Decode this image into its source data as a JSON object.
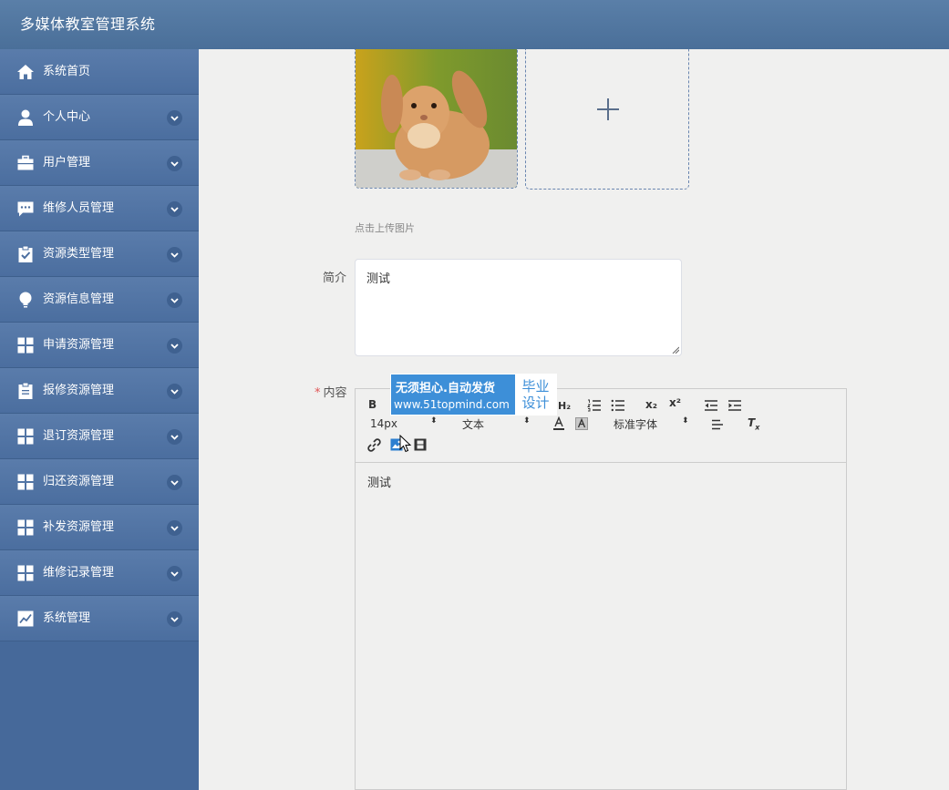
{
  "app": {
    "title": "多媒体教室管理系统"
  },
  "sidebar": {
    "items": [
      {
        "label": "系统首页",
        "icon": "home-icon",
        "expandable": false
      },
      {
        "label": "个人中心",
        "icon": "user-icon",
        "expandable": true
      },
      {
        "label": "用户管理",
        "icon": "briefcase-icon",
        "expandable": true
      },
      {
        "label": "维修人员管理",
        "icon": "chat-icon",
        "expandable": true
      },
      {
        "label": "资源类型管理",
        "icon": "clipboard-check-icon",
        "expandable": true
      },
      {
        "label": "资源信息管理",
        "icon": "bulb-icon",
        "expandable": true
      },
      {
        "label": "申请资源管理",
        "icon": "grid-icon",
        "expandable": true
      },
      {
        "label": "报修资源管理",
        "icon": "clipboard-icon",
        "expandable": true
      },
      {
        "label": "退订资源管理",
        "icon": "grid-icon",
        "expandable": true
      },
      {
        "label": "归还资源管理",
        "icon": "grid-icon",
        "expandable": true
      },
      {
        "label": "补发资源管理",
        "icon": "grid-icon",
        "expandable": true
      },
      {
        "label": "维修记录管理",
        "icon": "grid-icon",
        "expandable": true
      },
      {
        "label": "系统管理",
        "icon": "chart-icon",
        "expandable": true
      }
    ]
  },
  "form": {
    "upload_hint": "点击上传图片",
    "intro_label": "简介",
    "intro_value": "测试",
    "content_required_mark": "*",
    "content_label": "内容",
    "content_value": "测试"
  },
  "editor": {
    "toolbar": {
      "bold": "B",
      "subscript": "x₂",
      "superscript": "x²",
      "font_size": "14px",
      "format": "文本",
      "font_family": "标准字体"
    }
  },
  "watermark": {
    "line1": "无须担心.自动发货",
    "line2": "www.51topmind.com",
    "box_line1": "毕业",
    "box_line2": "设计"
  },
  "colors": {
    "header": "#4f76a2",
    "sidebar": "#46699a",
    "content_bg": "#f0f0ef",
    "accent": "#3d8fd8"
  }
}
